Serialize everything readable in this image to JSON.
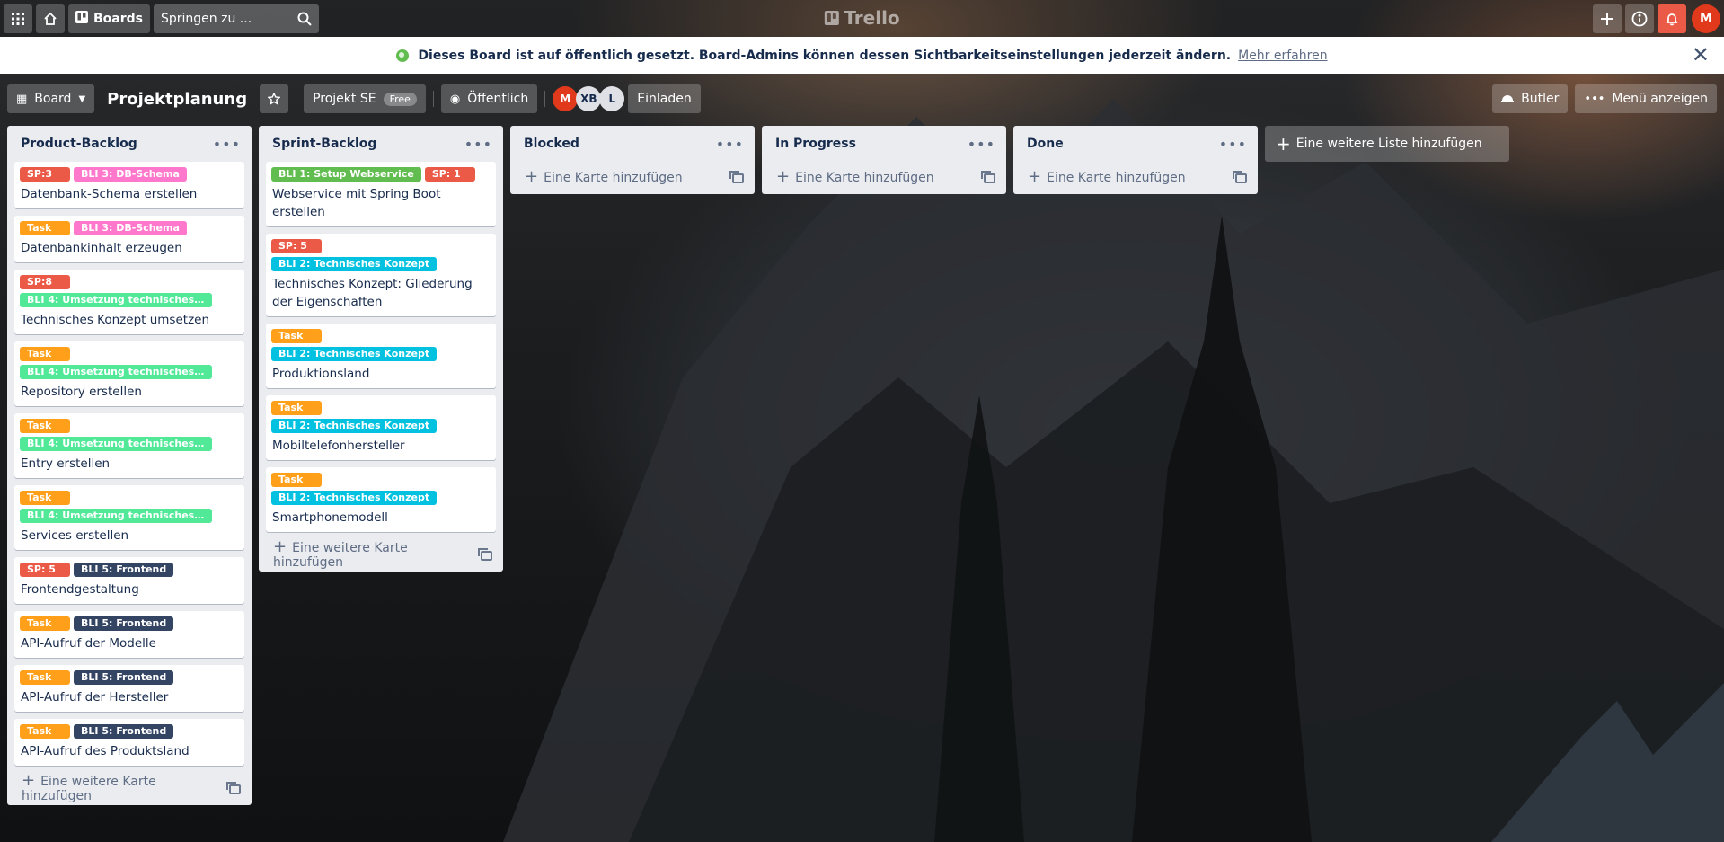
{
  "colors": {
    "orange": "#ff9f1a",
    "red": "#eb5a46",
    "pink": "#ff78cb",
    "green": "#51e898",
    "lime": "#61bd4f",
    "sky": "#00c2e0",
    "navy": "#344563"
  },
  "header": {
    "boards_label": "Boards",
    "search_placeholder": "Springen zu ...",
    "logo_text": "Trello",
    "avatar_initial": "M"
  },
  "banner": {
    "text": "Dieses Board ist auf öffentlich gesetzt. Board-Admins können dessen Sichtbarkeitseinstellungen jederzeit ändern.",
    "link": "Mehr erfahren"
  },
  "board": {
    "view_label": "Board",
    "title": "Projektplanung",
    "team_label": "Projekt SE",
    "team_badge": "Free",
    "visibility_label": "Öffentlich",
    "members": [
      "M",
      "XB",
      "L"
    ],
    "invite_label": "Einladen",
    "butler_label": "Butler",
    "menu_label": "Menü anzeigen"
  },
  "lists": [
    {
      "title": "Product-Backlog",
      "add_card": "Eine weitere Karte hinzufügen",
      "cards": [
        {
          "labels": [
            {
              "text": "SP:3",
              "color": "red"
            },
            {
              "text": "BLI 3: DB-Schema",
              "color": "pink"
            }
          ],
          "title": "Datenbank-Schema erstellen"
        },
        {
          "labels": [
            {
              "text": "Task",
              "color": "orange"
            },
            {
              "text": "BLI 3: DB-Schema",
              "color": "pink"
            }
          ],
          "title": "Datenbankinhalt erzeugen"
        },
        {
          "labels": [
            {
              "text": "SP:8",
              "color": "red"
            },
            {
              "text": "BLI 4: Umsetzung technisches Ko...",
              "color": "green"
            }
          ],
          "title": "Technisches Konzept umsetzen"
        },
        {
          "labels": [
            {
              "text": "Task",
              "color": "orange"
            },
            {
              "text": "BLI 4: Umsetzung technisches Ko...",
              "color": "green"
            }
          ],
          "title": "Repository erstellen"
        },
        {
          "labels": [
            {
              "text": "Task",
              "color": "orange"
            },
            {
              "text": "BLI 4: Umsetzung technisches Ko...",
              "color": "green"
            }
          ],
          "title": "Entry erstellen"
        },
        {
          "labels": [
            {
              "text": "Task",
              "color": "orange"
            },
            {
              "text": "BLI 4: Umsetzung technisches Ko...",
              "color": "green"
            }
          ],
          "title": "Services erstellen"
        },
        {
          "labels": [
            {
              "text": "SP: 5",
              "color": "red"
            },
            {
              "text": "BLI 5: Frontend",
              "color": "navy"
            }
          ],
          "title": "Frontendgestaltung"
        },
        {
          "labels": [
            {
              "text": "Task",
              "color": "orange"
            },
            {
              "text": "BLI 5: Frontend",
              "color": "navy"
            }
          ],
          "title": "API-Aufruf der Modelle"
        },
        {
          "labels": [
            {
              "text": "Task",
              "color": "orange"
            },
            {
              "text": "BLI 5: Frontend",
              "color": "navy"
            }
          ],
          "title": "API-Aufruf der Hersteller"
        },
        {
          "labels": [
            {
              "text": "Task",
              "color": "orange"
            },
            {
              "text": "BLI 5: Frontend",
              "color": "navy"
            }
          ],
          "title": "API-Aufruf des Produktsland"
        }
      ]
    },
    {
      "title": "Sprint-Backlog",
      "add_card": "Eine weitere Karte hinzufügen",
      "cards": [
        {
          "labels": [
            {
              "text": "BLI 1: Setup Webservice",
              "color": "lime"
            },
            {
              "text": "SP: 1",
              "color": "red"
            }
          ],
          "title": "Webservice mit Spring Boot erstellen"
        },
        {
          "labels": [
            {
              "text": "SP: 5",
              "color": "red"
            },
            {
              "text": "BLI 2: Technisches Konzept",
              "color": "sky"
            }
          ],
          "title": "Technisches Konzept: Gliederung der Eigenschaften"
        },
        {
          "labels": [
            {
              "text": "Task",
              "color": "orange"
            },
            {
              "text": "BLI 2: Technisches Konzept",
              "color": "sky"
            }
          ],
          "title": "Produktionsland"
        },
        {
          "labels": [
            {
              "text": "Task",
              "color": "orange"
            },
            {
              "text": "BLI 2: Technisches Konzept",
              "color": "sky"
            }
          ],
          "title": "Mobiltelefonhersteller"
        },
        {
          "labels": [
            {
              "text": "Task",
              "color": "orange"
            },
            {
              "text": "BLI 2: Technisches Konzept",
              "color": "sky"
            }
          ],
          "title": "Smartphonemodell"
        }
      ]
    },
    {
      "title": "Blocked",
      "add_card": "Eine Karte hinzufügen",
      "cards": []
    },
    {
      "title": "In Progress",
      "add_card": "Eine Karte hinzufügen",
      "cards": []
    },
    {
      "title": "Done",
      "add_card": "Eine Karte hinzufügen",
      "cards": []
    }
  ],
  "add_list_label": "Eine weitere Liste hinzufügen"
}
